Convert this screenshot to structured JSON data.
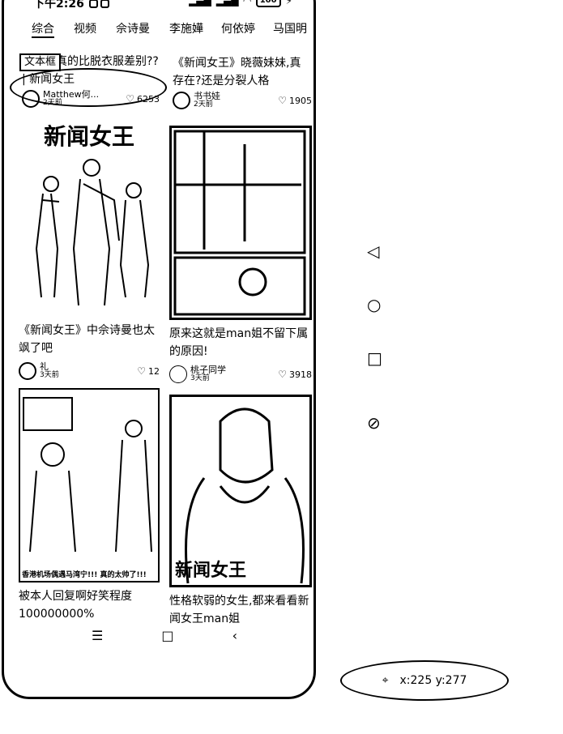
{
  "status": {
    "time": "下午2:26",
    "battery": "100"
  },
  "tabs": [
    "综合",
    "视频",
    "佘诗曼",
    "李施嬅",
    "何依婷",
    "马国明"
  ],
  "annotation_tag": "文本框",
  "cards": [
    {
      "title": "衣衣服真的比脱衣服差别?? | 新闻女王",
      "author": "Matthew何...",
      "date": "2天前",
      "likes": "6253"
    },
    {
      "title": "《新闻女王》晓薇妹妹,真存在?还是分裂人格",
      "author": "书书娃",
      "date": "2天前",
      "likes": "1905"
    },
    {
      "image_text": "新闻女王",
      "title": "《新闻女王》中佘诗曼也太飒了吧",
      "author": "礼",
      "date": "3天前",
      "likes": "12"
    },
    {
      "title": "原来这就是man姐不留下属的原因!",
      "author": "桃子同学",
      "date": "3天前",
      "likes": "3918"
    },
    {
      "image_caption": "香港机场偶遇马湾宁!!! 真的太帅了!!!",
      "title": "被本人回复啊好笑程度100000000%"
    },
    {
      "image_text": "新闻女王",
      "title": "性格软弱的女生,都来看看新闻女王man姐"
    }
  ],
  "navbar": {
    "menu": "☰",
    "home": "□",
    "back": "‹"
  },
  "side_icons": [
    "back-triangle-icon",
    "home-circle-icon",
    "recents-square-icon",
    "rotate-icon"
  ],
  "coord_readout": "x:225 y:277"
}
